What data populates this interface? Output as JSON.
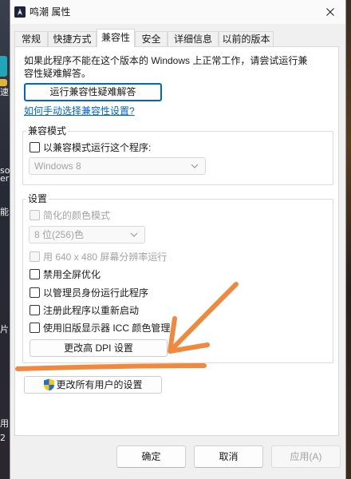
{
  "window": {
    "title": "鸣潮 属性"
  },
  "tabs": [
    {
      "label": "常规",
      "selected": false
    },
    {
      "label": "快捷方式",
      "selected": false
    },
    {
      "label": "兼容性",
      "selected": true
    },
    {
      "label": "安全",
      "selected": false
    },
    {
      "label": "详细信息",
      "selected": false
    },
    {
      "label": "以前的版本",
      "selected": false
    }
  ],
  "compatibility_tab": {
    "intro_lines": [
      "如果此程序不能在这个版本的 Windows 上正常工作，请尝试运行兼",
      "容性疑难解答。"
    ],
    "troubleshooter_button": "运行兼容性疑难解答",
    "manual_link": "如何手动选择兼容性设置?",
    "compat_mode": {
      "group_label": "兼容模式",
      "checkbox": {
        "label": "以兼容模式运行这个程序:",
        "checked": false,
        "enabled": true
      },
      "os_select": {
        "value": "Windows 8",
        "enabled": false
      }
    },
    "settings": {
      "group_label": "设置",
      "reduced_color": {
        "label": "简化的颜色模式",
        "checked": false,
        "enabled": false
      },
      "color_select": {
        "value": "8 位(256)色",
        "enabled": false
      },
      "low_resolution": {
        "label": "用 640 x 480 屏幕分辨率运行",
        "checked": false,
        "enabled": false
      },
      "disable_fullscreen_opt": {
        "label": "禁用全屏优化",
        "checked": false,
        "enabled": true
      },
      "run_as_admin": {
        "label": "以管理员身份运行此程序",
        "checked": false,
        "enabled": true
      },
      "register_restart": {
        "label": "注册此程序以重新启动",
        "checked": false,
        "enabled": true
      },
      "legacy_icc": {
        "label": "使用旧版显示器 ICC 颜色管理",
        "checked": false,
        "enabled": true
      },
      "high_dpi_button": "更改高 DPI 设置"
    },
    "all_users_button": "更改所有用户的设置"
  },
  "footer": {
    "ok": "确定",
    "cancel": "取消",
    "apply": "应用(A)",
    "apply_enabled": false
  },
  "desktop": {
    "fragments": [
      "速",
      "so",
      "er",
      "能",
      "片",
      "用",
      "2"
    ]
  },
  "colors": {
    "accent": "#0067c0",
    "link": "#0066cc",
    "annotation": "#f0883e",
    "disabled_text": "#a3a3a3"
  },
  "icons": {
    "app": "wuthering-waves-app-icon",
    "close": "close-icon",
    "dropdown": "chevron-down-icon",
    "elevation": "uac-shield-icon",
    "annotation": "hand-drawn-arrow"
  }
}
